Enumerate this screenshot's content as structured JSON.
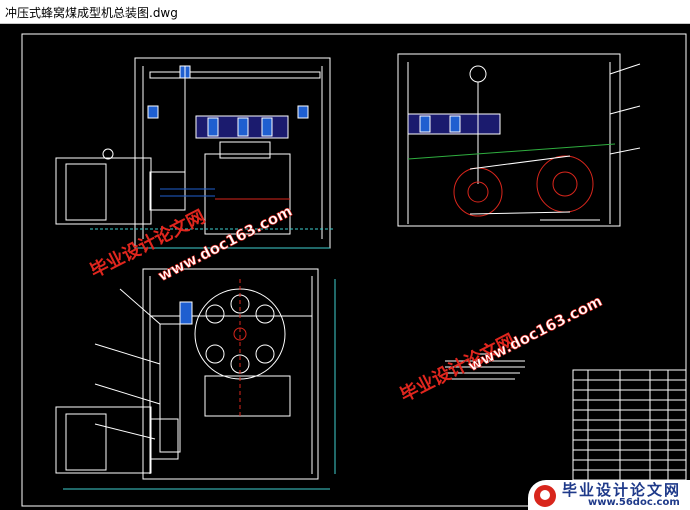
{
  "window": {
    "title": "冲压式蜂窝煤成型机总装图.dwg"
  },
  "watermarks": [
    {
      "main": "毕业设计论文网",
      "url": "www.doc163.com"
    },
    {
      "main": "毕业设计论文网",
      "url": "www.doc163.com"
    }
  ],
  "footer_logo": {
    "brand": "毕业设计论文网",
    "url": "www.56doc.com"
  },
  "colors": {
    "background": "#000000",
    "drawing_white": "#ffffff",
    "watermark_red": "#e0261e",
    "logo_blue": "#1f3a8a"
  }
}
